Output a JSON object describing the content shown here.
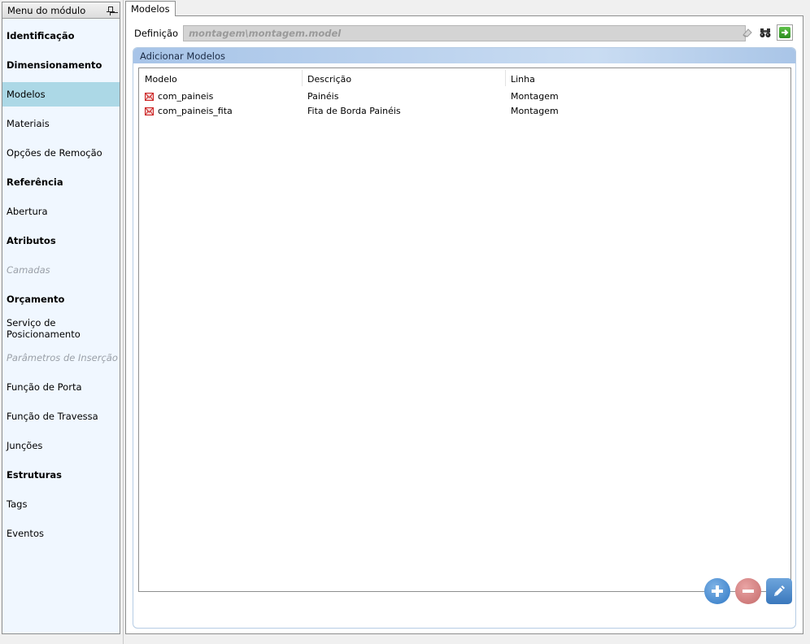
{
  "sidebar": {
    "title": "Menu do módulo",
    "items": [
      {
        "label": "Identificação",
        "style": "bold"
      },
      {
        "label": "Dimensionamento",
        "style": "bold"
      },
      {
        "label": "Modelos",
        "style": "active"
      },
      {
        "label": "Materiais",
        "style": "normal"
      },
      {
        "label": "Opções de Remoção",
        "style": "normal"
      },
      {
        "label": "Referência",
        "style": "bold"
      },
      {
        "label": "Abertura",
        "style": "normal"
      },
      {
        "label": "Atributos",
        "style": "bold"
      },
      {
        "label": "Camadas",
        "style": "disabled"
      },
      {
        "label": "Orçamento",
        "style": "bold"
      },
      {
        "label": "Serviço de Posicionamento",
        "style": "normal"
      },
      {
        "label": "Parâmetros de Inserção",
        "style": "disabled"
      },
      {
        "label": "Função de Porta",
        "style": "normal"
      },
      {
        "label": "Função de Travessa",
        "style": "normal"
      },
      {
        "label": "Junções",
        "style": "normal"
      },
      {
        "label": "Estruturas",
        "style": "bold"
      },
      {
        "label": "Tags",
        "style": "normal"
      },
      {
        "label": "Eventos",
        "style": "normal"
      }
    ]
  },
  "tab": {
    "label": "Modelos"
  },
  "definition": {
    "label": "Definição",
    "value": "montagem\\montagem.model"
  },
  "group": {
    "title": "Adicionar Modelos"
  },
  "table": {
    "columns": [
      "Modelo",
      "Descrição",
      "Linha"
    ],
    "rows": [
      {
        "modelo": "com_paineis",
        "descricao": "Painéis",
        "linha": "Montagem"
      },
      {
        "modelo": "com_paineis_fita",
        "descricao": "Fita de Borda Painéis",
        "linha": "Montagem"
      }
    ]
  },
  "icons": {
    "pin": "pin-icon",
    "eraser": "eraser-icon",
    "binoculars": "binoculars-icon",
    "go": "arrow-right-icon",
    "model": "model-file-icon",
    "add": "plus-icon",
    "remove": "minus-icon",
    "edit": "pencil-icon"
  },
  "colors": {
    "active_item": "#acd8e6",
    "group_header": "#b9d1ee",
    "add": "#2f78c5",
    "remove": "#c46a6a"
  }
}
